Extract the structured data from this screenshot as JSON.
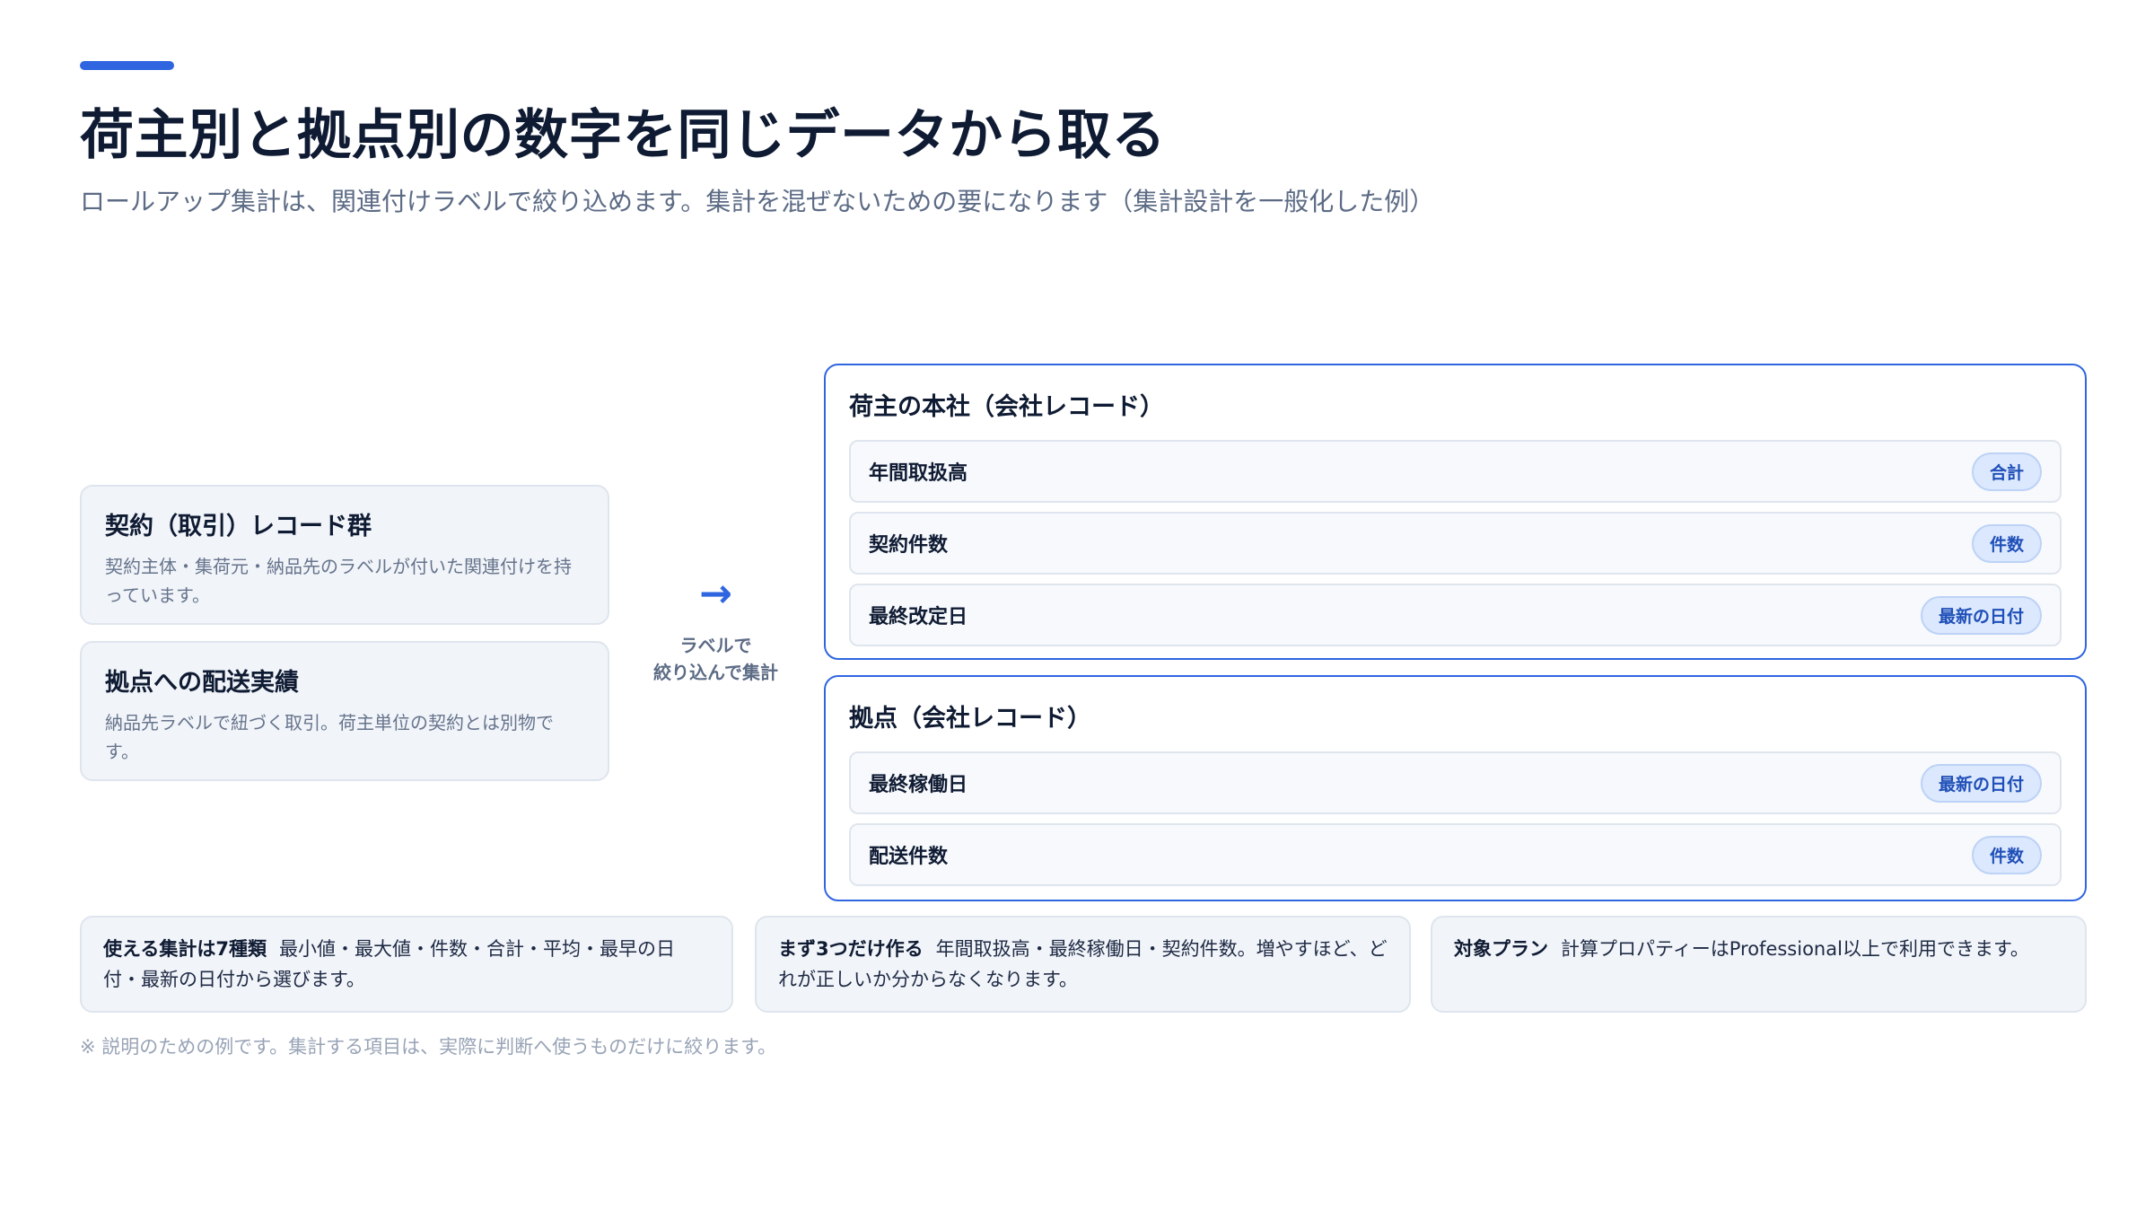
{
  "header": {
    "title": "荷主別と拠点別の数字を同じデータから取る",
    "subtitle": "ロールアップ集計は、関連付けラベルで絞り込めます。集計を混ぜないための要になります（集計設計を一般化した例）"
  },
  "sources": [
    {
      "title": "契約（取引）レコード群",
      "desc": "契約主体・集荷元・納品先のラベルが付いた関連付けを持っています。"
    },
    {
      "title": "拠点への配送実績",
      "desc": "納品先ラベルで紐づく取引。荷主単位の契約とは別物です。"
    }
  ],
  "flow": {
    "icon": "arrow-right-icon",
    "label_line1": "ラベルで",
    "label_line2": "絞り込んで集計"
  },
  "targets": {
    "hq": {
      "title": "荷主の本社（会社レコード）",
      "rows": [
        {
          "name": "年間取扱高",
          "badge": "合計"
        },
        {
          "name": "契約件数",
          "badge": "件数"
        },
        {
          "name": "最終改定日",
          "badge": "最新の日付"
        }
      ]
    },
    "base": {
      "title": "拠点（会社レコード）",
      "rows": [
        {
          "name": "最終稼働日",
          "badge": "最新の日付"
        },
        {
          "name": "配送件数",
          "badge": "件数"
        }
      ]
    }
  },
  "info": [
    {
      "lead": "使える集計は7種類",
      "text": "最小値・最大値・件数・合計・平均・最早の日付・最新の日付から選びます。"
    },
    {
      "lead": "まず3つだけ作る",
      "text": "年間取扱高・最終稼働日・契約件数。増やすほど、どれが正しいか分からなくなります。"
    },
    {
      "lead": "対象プラン",
      "text": "計算プロパティーはProfessional以上で利用できます。"
    }
  ],
  "footnote": "※ 説明のための例です。集計する項目は、実際に判断へ使うものだけに絞ります。",
  "colors": {
    "accent": "#2f66e0",
    "badge_bg": "#dce8fd",
    "badge_text": "#1f4fb8"
  }
}
